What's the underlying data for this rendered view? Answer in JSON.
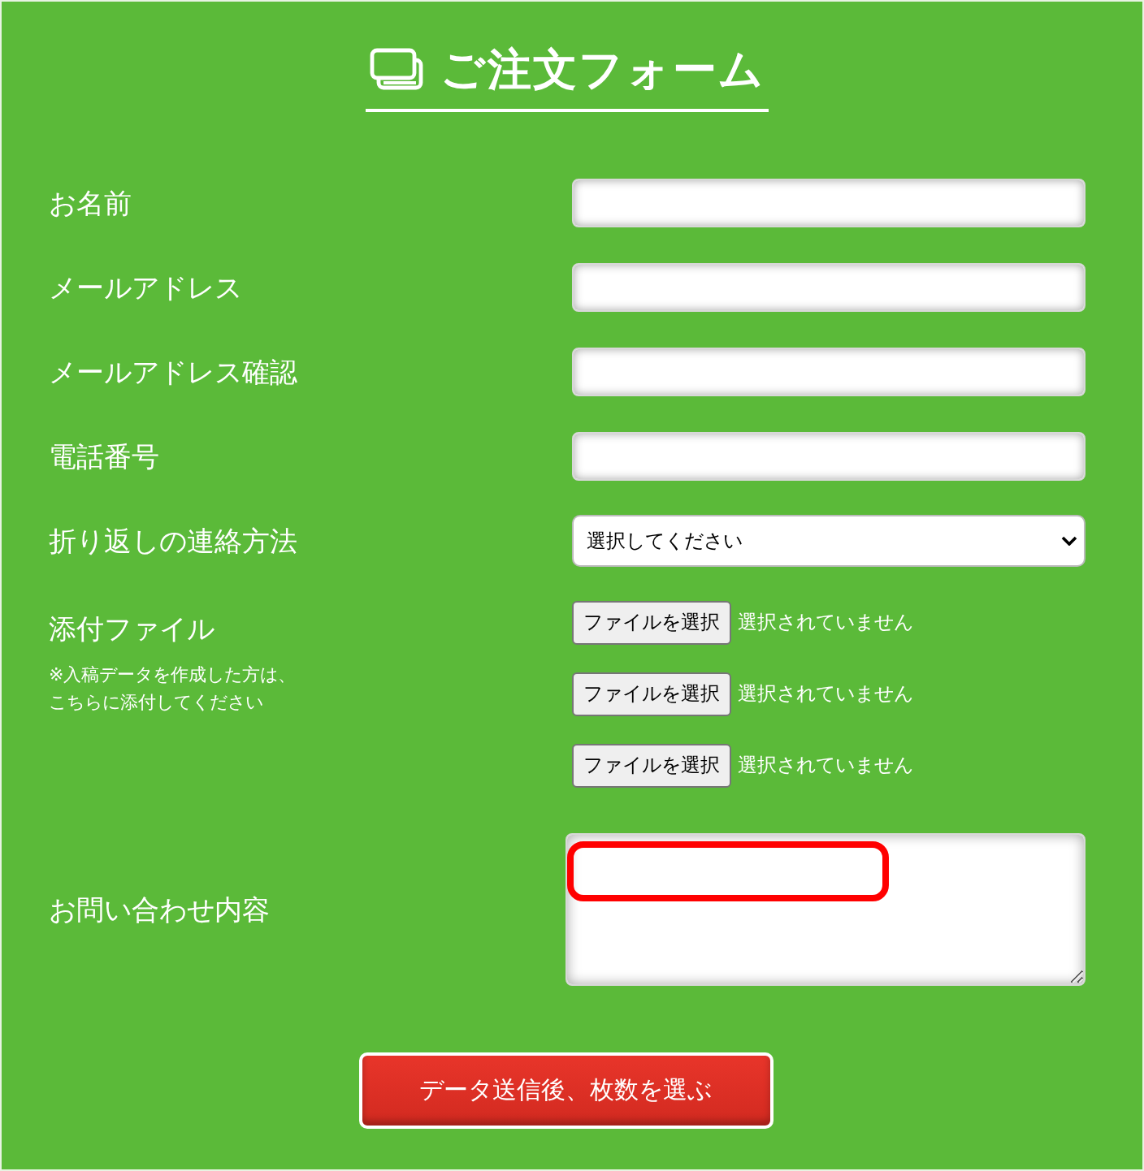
{
  "title": "ご注文フォーム",
  "fields": [
    {
      "kind": "text",
      "label": "お名前"
    },
    {
      "kind": "text",
      "label": "メールアドレス"
    },
    {
      "kind": "text",
      "label": "メールアドレス確認"
    },
    {
      "kind": "text",
      "label": "電話番号"
    },
    {
      "kind": "select",
      "label": "折り返しの連絡方法",
      "value": "選択してください"
    }
  ],
  "attachments": {
    "label": "添付ファイル",
    "note": [
      "※入稿データを作成した方は、",
      "こちらに添付してください"
    ],
    "files": [
      {
        "button": "ファイルを選択",
        "status": "選択されていません"
      },
      {
        "button": "ファイルを選択",
        "status": "選択されていません"
      },
      {
        "button": "ファイルを選択",
        "status": "選択されていません"
      }
    ]
  },
  "message": {
    "label": "お問い合わせ内容",
    "highlighted": true
  },
  "submit": "データ送信後、枚数を選ぶ"
}
